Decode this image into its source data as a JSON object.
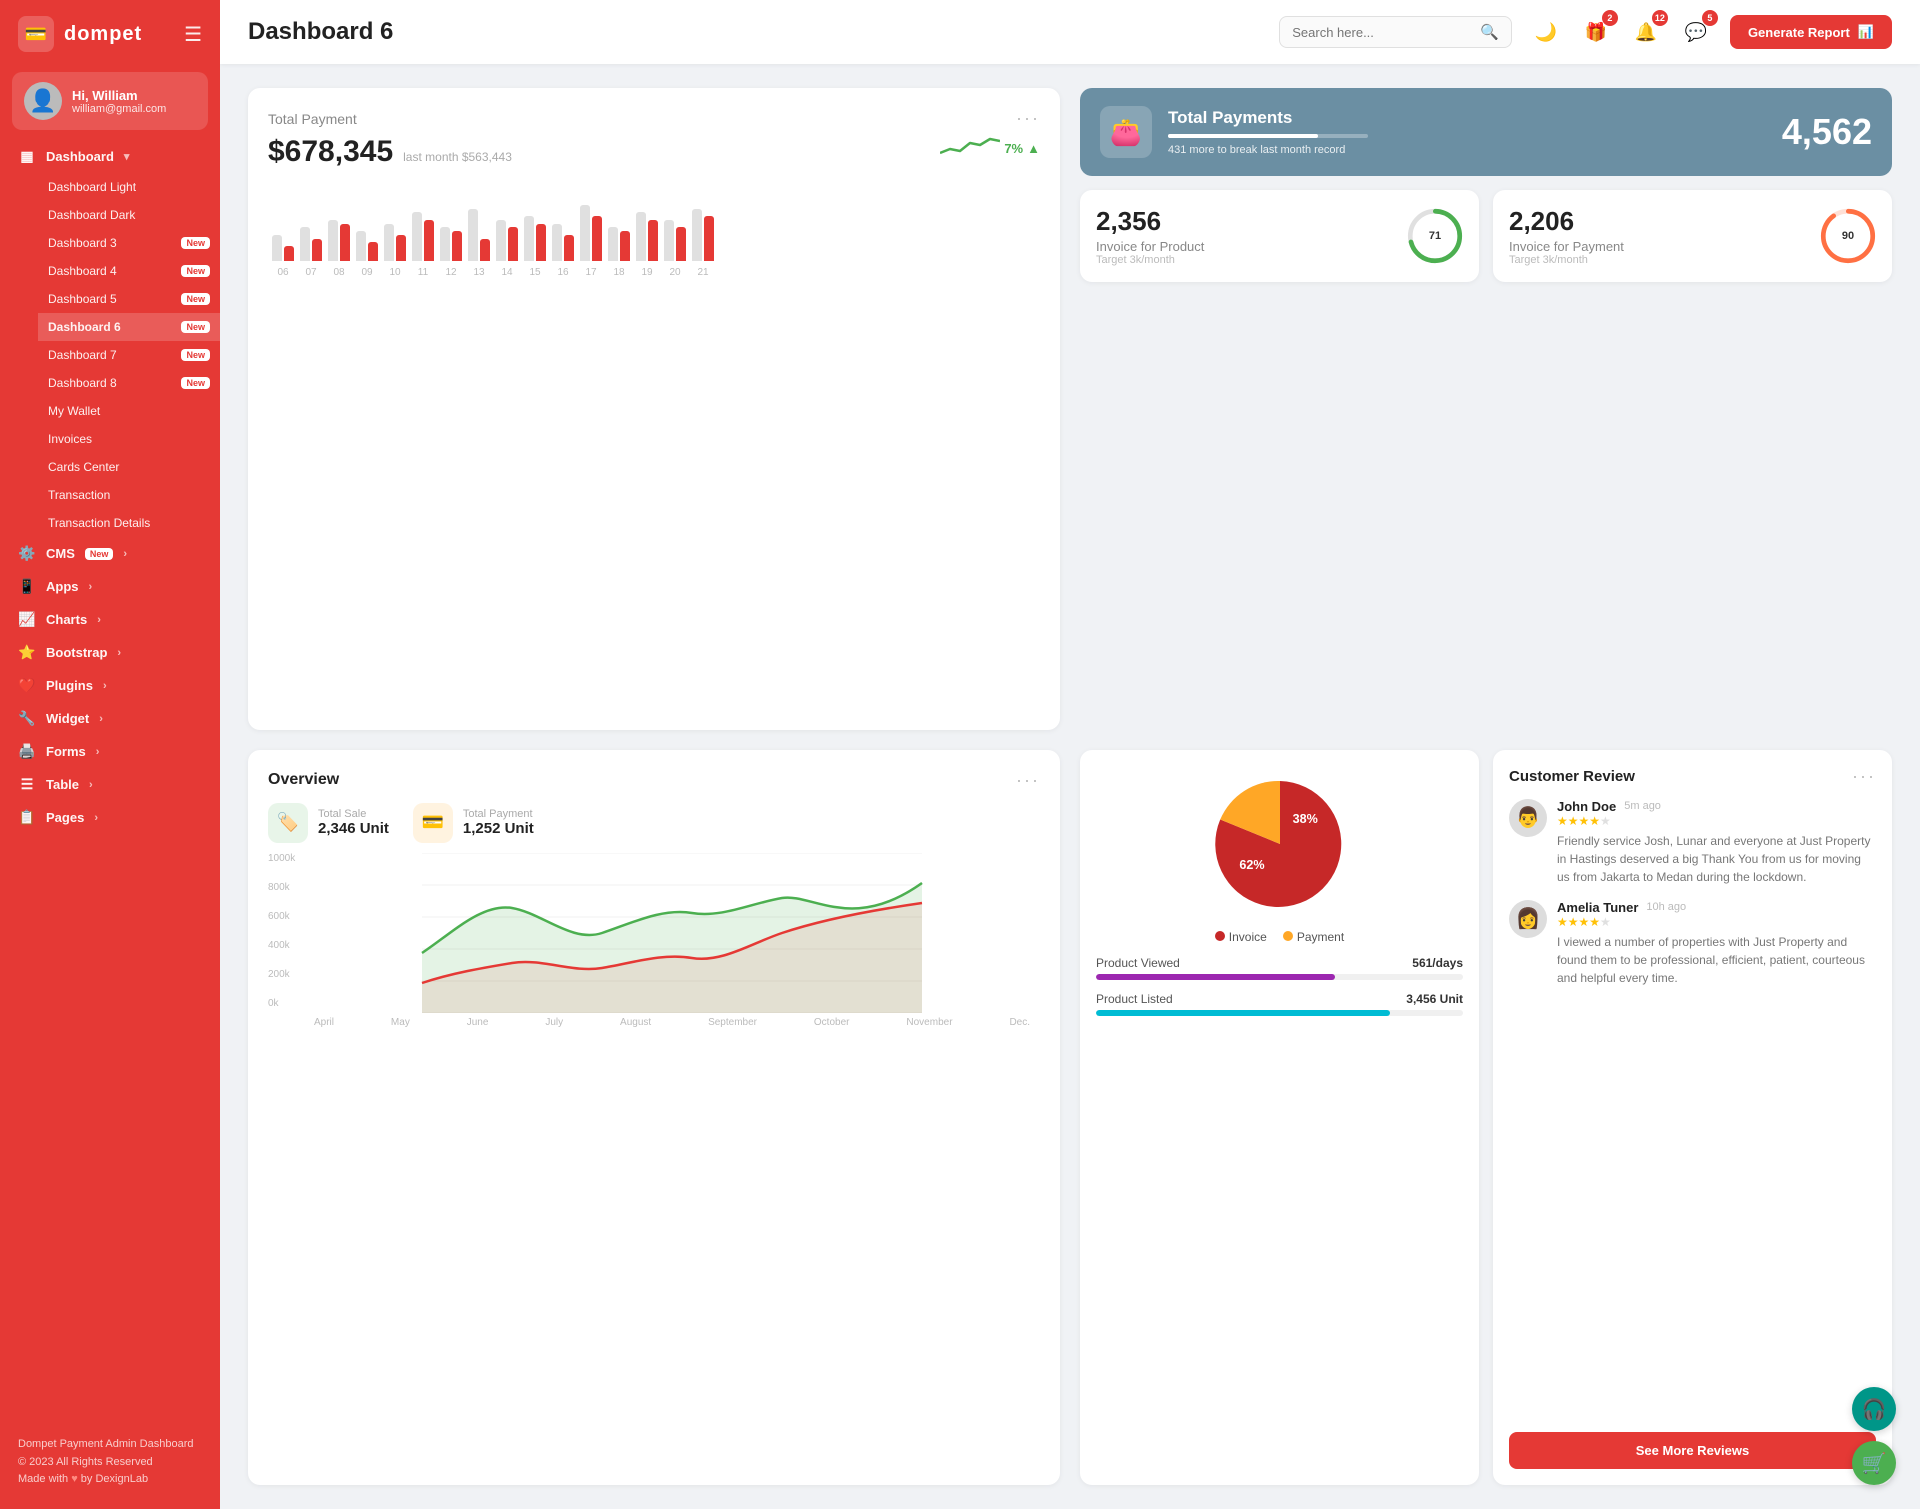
{
  "brand": {
    "name": "dompet",
    "logo_icon": "💳"
  },
  "user": {
    "greeting": "Hi, William",
    "name": "William",
    "email": "william@gmail.com",
    "avatar_icon": "👤"
  },
  "sidebar": {
    "dashboard_label": "Dashboard",
    "items": [
      {
        "label": "Dashboard Light",
        "id": "dashboard-light"
      },
      {
        "label": "Dashboard Dark",
        "id": "dashboard-dark"
      },
      {
        "label": "Dashboard 3",
        "id": "dashboard-3",
        "badge": "New"
      },
      {
        "label": "Dashboard 4",
        "id": "dashboard-4",
        "badge": "New"
      },
      {
        "label": "Dashboard 5",
        "id": "dashboard-5",
        "badge": "New"
      },
      {
        "label": "Dashboard 6",
        "id": "dashboard-6",
        "badge": "New",
        "active": true
      },
      {
        "label": "Dashboard 7",
        "id": "dashboard-7",
        "badge": "New"
      },
      {
        "label": "Dashboard 8",
        "id": "dashboard-8",
        "badge": "New"
      },
      {
        "label": "My Wallet",
        "id": "my-wallet"
      },
      {
        "label": "Invoices",
        "id": "invoices"
      },
      {
        "label": "Cards Center",
        "id": "cards-center"
      },
      {
        "label": "Transaction",
        "id": "transaction"
      },
      {
        "label": "Transaction Details",
        "id": "transaction-details"
      }
    ],
    "nav_groups": [
      {
        "label": "CMS",
        "badge": "New",
        "icon": "⚙️"
      },
      {
        "label": "Apps",
        "icon": "📱"
      },
      {
        "label": "Charts",
        "icon": "📈"
      },
      {
        "label": "Bootstrap",
        "icon": "⭐"
      },
      {
        "label": "Plugins",
        "icon": "❤️"
      },
      {
        "label": "Widget",
        "icon": "🔧"
      },
      {
        "label": "Forms",
        "icon": "🖨️"
      },
      {
        "label": "Table",
        "icon": "☰"
      },
      {
        "label": "Pages",
        "icon": "📋"
      }
    ],
    "footer": {
      "title": "Dompet Payment Admin Dashboard",
      "copyright": "© 2023 All Rights Reserved",
      "made_with": "Made with",
      "by": "by DexignLab"
    }
  },
  "topbar": {
    "page_title": "Dashboard 6",
    "search_placeholder": "Search here...",
    "icons": {
      "moon_icon": "🌙",
      "gift_icon": "🎁",
      "bell_icon": "🔔",
      "chat_icon": "💬"
    },
    "badges": {
      "gift": "2",
      "bell": "12",
      "chat": "5"
    },
    "generate_btn": "Generate Report"
  },
  "total_payment": {
    "title": "Total Payment",
    "amount": "$678,345",
    "last_month_label": "last month $563,443",
    "change": "7%",
    "change_icon": "▲",
    "bars": [
      {
        "gray": 35,
        "red": 20
      },
      {
        "gray": 45,
        "red": 30
      },
      {
        "gray": 55,
        "red": 50
      },
      {
        "gray": 40,
        "red": 25
      },
      {
        "gray": 50,
        "red": 35
      },
      {
        "gray": 65,
        "red": 55
      },
      {
        "gray": 45,
        "red": 40
      },
      {
        "gray": 70,
        "red": 30
      },
      {
        "gray": 55,
        "red": 45
      },
      {
        "gray": 60,
        "red": 50
      },
      {
        "gray": 50,
        "red": 35
      },
      {
        "gray": 75,
        "red": 60
      },
      {
        "gray": 45,
        "red": 40
      },
      {
        "gray": 65,
        "red": 55
      },
      {
        "gray": 55,
        "red": 45
      },
      {
        "gray": 70,
        "red": 60
      }
    ],
    "bar_labels": [
      "06",
      "07",
      "08",
      "09",
      "10",
      "11",
      "12",
      "13",
      "14",
      "15",
      "16",
      "17",
      "18",
      "19",
      "20",
      "21"
    ],
    "menu": "···"
  },
  "total_payments_blue": {
    "title": "Total Payments",
    "sub": "431 more to break last month record",
    "number": "4,562",
    "progress": 75
  },
  "invoice_product": {
    "number": "2,356",
    "label": "Invoice for Product",
    "target": "Target 3k/month",
    "percent": 71,
    "color": "#4caf50"
  },
  "invoice_payment": {
    "number": "2,206",
    "label": "Invoice for Payment",
    "target": "Target 3k/month",
    "percent": 90,
    "color": "#ff7043"
  },
  "overview": {
    "title": "Overview",
    "menu": "···",
    "total_sale": {
      "label": "Total Sale",
      "value": "2,346 Unit",
      "icon": "🏷️"
    },
    "total_payment": {
      "label": "Total Payment",
      "value": "1,252 Unit",
      "icon": "💳"
    },
    "x_labels": [
      "April",
      "May",
      "June",
      "July",
      "August",
      "September",
      "October",
      "November",
      "Dec."
    ],
    "y_labels": [
      "1000k",
      "800k",
      "600k",
      "400k",
      "200k",
      "0k"
    ]
  },
  "pie_chart": {
    "invoice_pct": 62,
    "payment_pct": 38,
    "invoice_color": "#c62828",
    "payment_color": "#ffa726",
    "legend_invoice": "Invoice",
    "legend_payment": "Payment",
    "product_viewed": {
      "label": "Product Viewed",
      "value": "561/days",
      "fill_pct": 65,
      "color": "#9c27b0"
    },
    "product_listed": {
      "label": "Product Listed",
      "value": "3,456 Unit",
      "fill_pct": 80,
      "color": "#00bcd4"
    }
  },
  "customer_review": {
    "title": "Customer Review",
    "menu": "···",
    "reviews": [
      {
        "name": "John Doe",
        "time": "5m ago",
        "stars": 4,
        "text": "Friendly service Josh, Lunar and everyone at Just Property in Hastings deserved a big Thank You from us for moving us from Jakarta to Medan during the lockdown.",
        "avatar_icon": "👨"
      },
      {
        "name": "Amelia Tuner",
        "time": "10h ago",
        "stars": 4,
        "text": "I viewed a number of properties with Just Property and found them to be professional, efficient, patient, courteous and helpful every time.",
        "avatar_icon": "👩"
      }
    ],
    "see_more_btn": "See More Reviews"
  },
  "float_btns": {
    "support_icon": "🎧",
    "cart_icon": "🛒"
  }
}
